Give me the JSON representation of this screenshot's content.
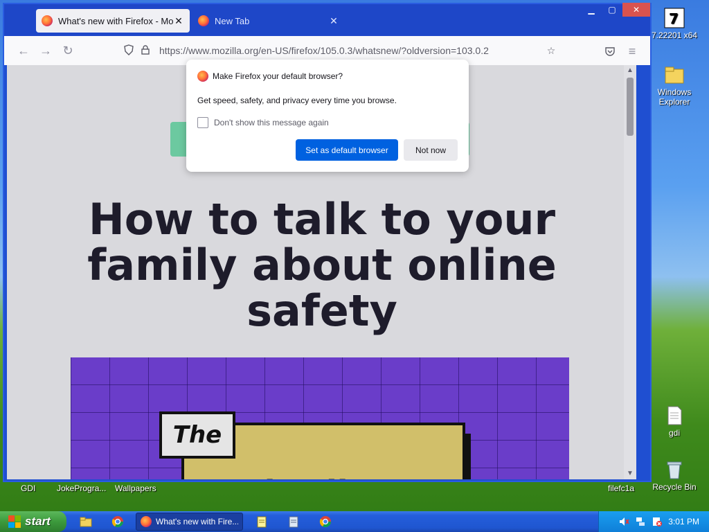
{
  "desktop": {
    "icons": [
      {
        "label": "7.22201 x64"
      },
      {
        "label": "Windows Explorer"
      },
      {
        "label": "gdi"
      },
      {
        "label": "Recycle Bin"
      }
    ],
    "bottom_labels": [
      "GDI",
      "JokeProgra...",
      "Wallpapers",
      "filefc1a"
    ]
  },
  "browser": {
    "tabs": [
      {
        "title": "What's new with Firefox - More",
        "active": true
      },
      {
        "title": "New Tab",
        "active": false
      }
    ],
    "url": "https://www.mozilla.org/en-US/firefox/105.0.3/whatsnew/?oldversion=103.0.2",
    "page": {
      "headline": "How to talk to your family about online safety",
      "hero_the": "The",
      "hero_brand": "TechTalk"
    },
    "popup": {
      "title": "Make Firefox your default browser?",
      "description": "Get speed, safety, and privacy every time you browse.",
      "checkbox_label": "Don't show this message again",
      "checkbox_checked": false,
      "primary_button": "Set as default browser",
      "secondary_button": "Not now"
    }
  },
  "taskbar": {
    "start_label": "start",
    "active_task": "What's new with Fire...",
    "clock": "3:01 PM"
  },
  "colors": {
    "primary_button": "#0061e0",
    "titlebar": "#1e47c8",
    "hero": "#6a3dc9"
  }
}
